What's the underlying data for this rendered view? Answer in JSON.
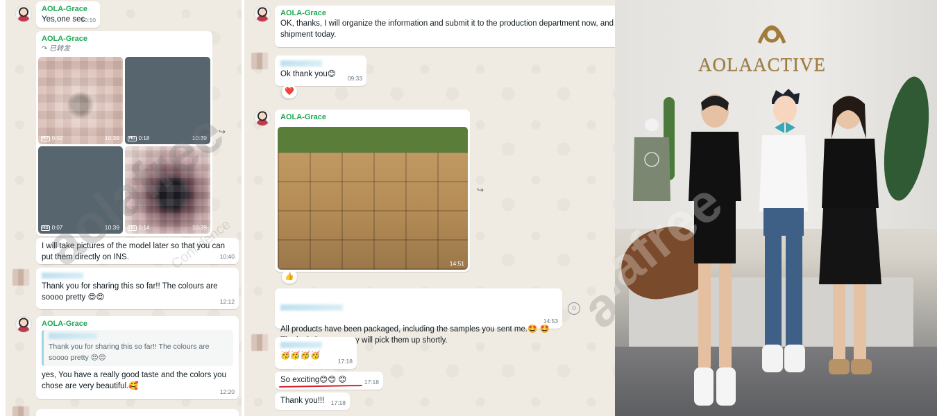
{
  "left_chat": {
    "msg1": {
      "sender": "AOLA-Grace",
      "text": "Yes,one sec",
      "time": "10:10"
    },
    "msg2": {
      "sender": "AOLA-Grace",
      "forwarded": "已转发",
      "media": [
        {
          "hd": "HD",
          "duration": "0:02",
          "time": "10:39"
        },
        {
          "hd": "HD",
          "duration": "0:18",
          "time": "10:39"
        },
        {
          "hd": "HD",
          "duration": "0:07",
          "time": "10:39"
        },
        {
          "hd": "HD",
          "duration": "0:14",
          "time": "10:39"
        }
      ]
    },
    "msg3": {
      "text": "I will take pictures of the model later so that you can put them directly on INS.",
      "time": "10:40"
    },
    "msg4": {
      "text": "Thank you for sharing this so far!! The colours are soooo pretty 😍😍",
      "time": "12:12"
    },
    "msg5": {
      "sender": "AOLA-Grace",
      "quote": "Thank you for sharing this so far!! The colours are soooo pretty 😍😍",
      "text": "yes, You have a really good taste and the colors you chose are very beautiful.🥰",
      "time": "12:20"
    }
  },
  "right_chat": {
    "msg1": {
      "sender": "AOLA-Grace",
      "text": "OK, thanks, I will organize the information and submit it to the production department now, and shipment today."
    },
    "msg2": {
      "text": "Ok thank you😊",
      "time": "09:33",
      "reaction": "❤️"
    },
    "msg3": {
      "sender": "AOLA-Grace",
      "time": "14:51",
      "reaction": "👍"
    },
    "msg4": {
      "text": "All products have been packaged, including the samples you sent me.🤩 🤩\nThe logistics company will pick them up shortly.",
      "time": "14:53"
    },
    "msg5": {
      "text": "🥳🥳🥳🥳",
      "time": "17:18"
    },
    "msg6": {
      "text": "So exciting😊😊 😊",
      "time": "17:18"
    },
    "msg7": {
      "text": "Thank you!!!",
      "time": "17:18"
    }
  },
  "watermarks": {
    "main": "aolafree",
    "sub": "Confidence"
  },
  "photo": {
    "brand": "AOLAACTIVE"
  },
  "icons": {
    "share": "share-forward-icon",
    "emoji": "emoji-smiley-icon",
    "play": "video-hd-icon"
  }
}
